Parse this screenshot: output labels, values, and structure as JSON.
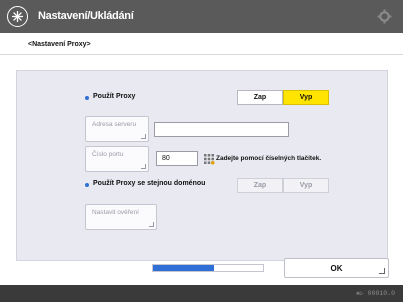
{
  "header": {
    "title": "Nastavení/Ukládání",
    "menu_icon": "menu-icon",
    "settings_icon": "gear-icon"
  },
  "breadcrumb": "<Nastavení Proxy>",
  "form": {
    "use_proxy": {
      "label": "Použít Proxy",
      "on_label": "Zap",
      "off_label": "Vyp",
      "selected": "Vyp"
    },
    "server_address": {
      "label": "Adresa serveru",
      "value": ""
    },
    "port_number": {
      "label": "Číslo portu",
      "value": "80",
      "hint": "Zadejte pomocí číselných tlačítek."
    },
    "same_proxy_domain": {
      "label": "Použít Proxy se stejnou doménou",
      "on_label": "Zap",
      "off_label": "Vyp"
    },
    "auth_settings": {
      "label": "Nastavit ověření"
    }
  },
  "footer": {
    "progress": 0.55,
    "ok_label": "OK"
  },
  "status": {
    "text": "❖▷ 00010.0"
  },
  "colors": {
    "accent": "#2f6fd6",
    "selected": "#ffe400",
    "titlebar": "#5a5a5a"
  }
}
